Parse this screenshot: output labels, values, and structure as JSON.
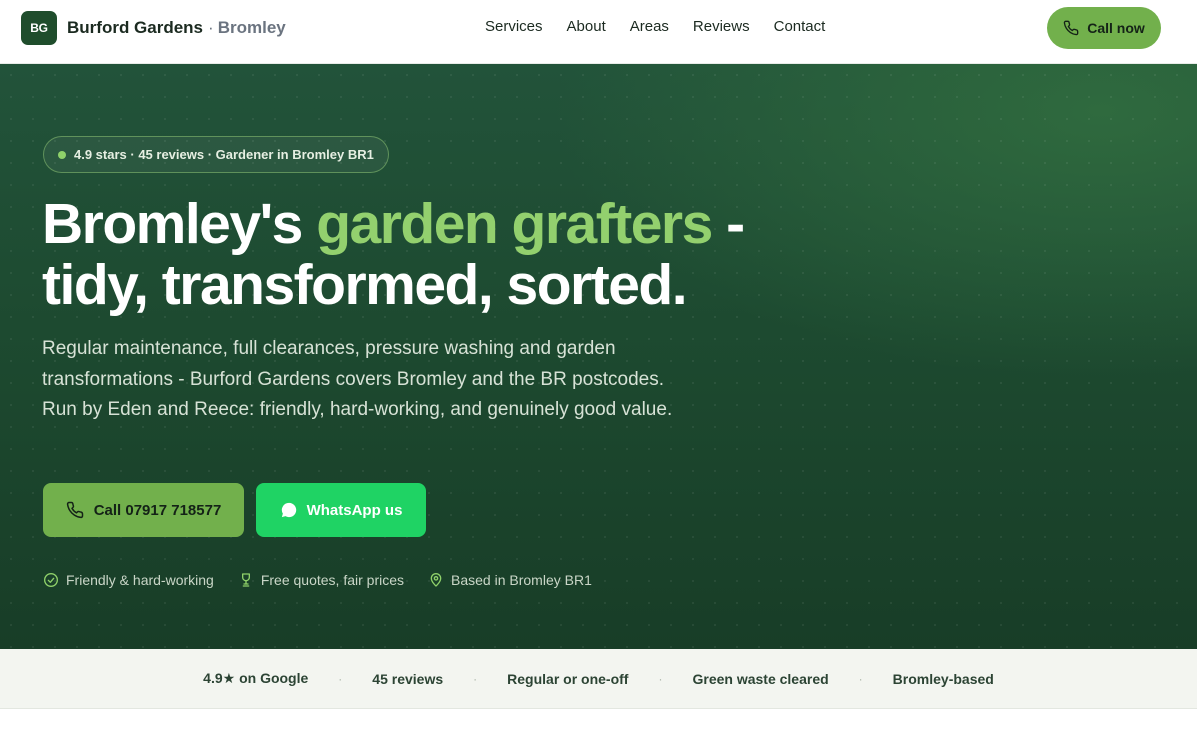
{
  "header": {
    "brand_mark": "BG",
    "brand_name": "Burford Gardens",
    "brand_sep": "·",
    "brand_location": "Bromley",
    "nav": [
      "Services",
      "About",
      "Areas",
      "Reviews",
      "Contact"
    ],
    "call_now_label": "Call now",
    "call_icon": "phone-icon"
  },
  "hero": {
    "badge_text": "4.9 stars · 45 reviews · Gardener in Bromley BR1",
    "headline_part1": "Bromley's ",
    "headline_accent": "garden grafters",
    "headline_part2": " - tidy, transformed, sorted.",
    "lede": "Regular maintenance, full clearances, pressure washing and garden transformations - Burford Gardens covers Bromley and the BR postcodes. Run by Eden and Reece: friendly, hard-working, and genuinely good value.",
    "call_button_label": "Call 07917 718577",
    "whatsapp_button_label": "WhatsApp us",
    "features": [
      {
        "icon": "check-circle-icon",
        "label": "Friendly & hard-working"
      },
      {
        "icon": "trophy-icon",
        "label": "Free quotes, fair prices"
      },
      {
        "icon": "map-pin-icon",
        "label": "Based in Bromley BR1"
      }
    ]
  },
  "strip": {
    "separator": "·",
    "items": [
      "4.9★ on Google",
      "45 reviews",
      "Regular or one-off",
      "Green waste cleared",
      "Bromley-based"
    ]
  },
  "colors": {
    "brand_dark": "#1f4d2c",
    "accent_green": "#72b04c",
    "headline_accent": "#93d06e",
    "whatsapp_green": "#1fd364",
    "hero_bg": "#1d4a30"
  }
}
